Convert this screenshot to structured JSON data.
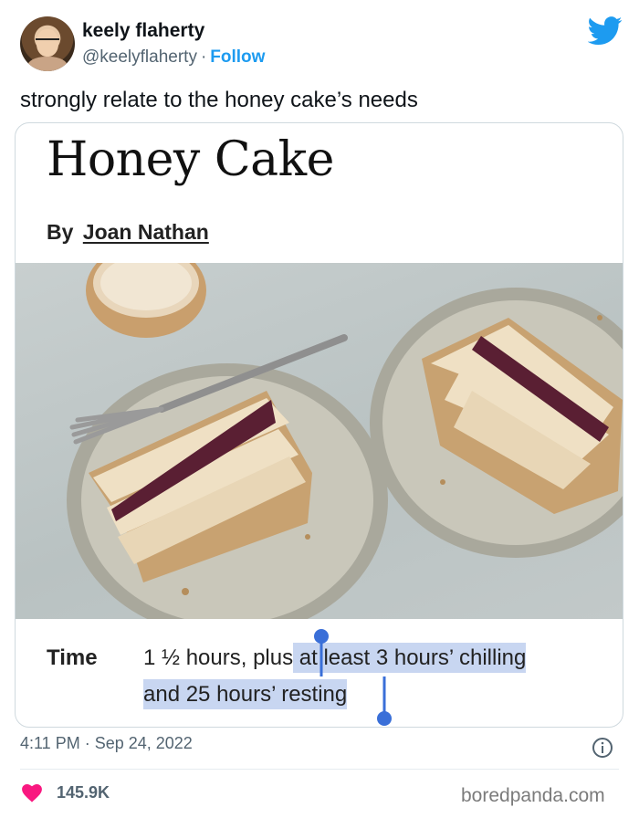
{
  "user": {
    "display_name": "keely flaherty",
    "handle": "@keelyflaherty",
    "separator": "·",
    "follow_label": "Follow"
  },
  "tweet": {
    "text": "strongly relate to the honey cake’s needs"
  },
  "recipe": {
    "title": "Honey Cake",
    "by_label": "By",
    "author": "Joan Nathan",
    "time_label": "Time",
    "time_unselected": "1 ½ hours, plus",
    "time_selected_line1": " at least 3 hours’ chilling",
    "time_selected_line2": "and 25 hours’ resting"
  },
  "meta": {
    "timestamp": "4:11 PM · Sep 24, 2022",
    "like_count": "145.9K"
  },
  "watermark": "boredpanda.com",
  "colors": {
    "brand_blue": "#1d9bf0",
    "heart_pink": "#f91880",
    "selection_bg": "#c8d6f1",
    "selection_handle": "#3a6fd8"
  },
  "icons": {
    "twitter": "twitter-bird-icon",
    "info": "info-icon",
    "heart": "heart-icon"
  }
}
